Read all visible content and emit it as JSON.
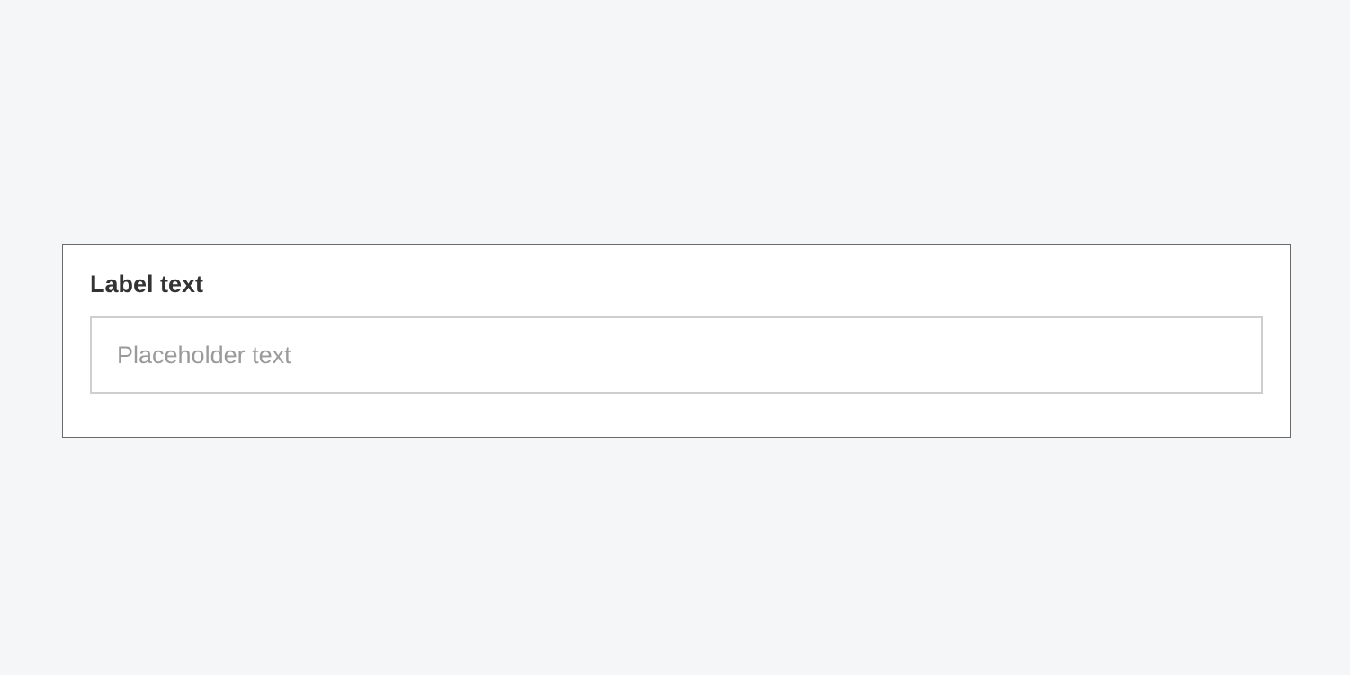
{
  "form": {
    "label": "Label text",
    "placeholder": "Placeholder text",
    "value": ""
  }
}
